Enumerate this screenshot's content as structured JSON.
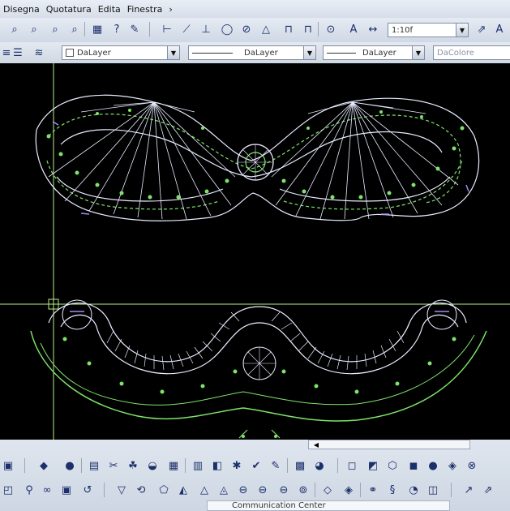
{
  "menu": {
    "items": [
      "Disegna",
      "Quotatura",
      "Edita",
      "Finestra"
    ],
    "more": "›"
  },
  "toolbar": {
    "scale_value": "1:10f"
  },
  "layers": {
    "layer_1": "DaLayer",
    "layer_2": "DaLayer",
    "layer_3": "DaLayer",
    "color": "DaColore"
  },
  "status": {
    "text": "Communication Center"
  },
  "colors": {
    "canvas": "#000000",
    "lines_white": "#e8ecff",
    "lines_green": "#7ee36a",
    "crosshair": "#b7f08a"
  }
}
